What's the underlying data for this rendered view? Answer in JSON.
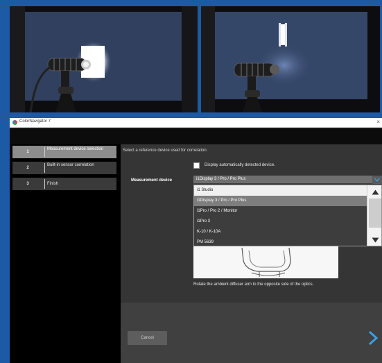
{
  "window": {
    "title": "ColorNavigator 7",
    "close_glyph": "×"
  },
  "steps": [
    {
      "number": "1",
      "label": "Measurement device selection",
      "active": true
    },
    {
      "number": "2",
      "label": "Built-in sensor correlation",
      "active": false
    },
    {
      "number": "3",
      "label": "Finish",
      "active": false
    }
  ],
  "main": {
    "instruction": "Select a reference device used for correlation.",
    "checkbox_label": "Display automatically detected device.",
    "checkbox_checked": false,
    "measurement_label": "Measurement device",
    "dropdown_value": "i1Display 3 / Pro / Pro Plus",
    "options": [
      "i1 Studio",
      "i1Display 3 / Pro / Pro Plus",
      "i1Pro / Pro 2 / Monitor",
      "i1Pro 3",
      "K-10 / K-10A",
      "PM 5639"
    ],
    "selected_index": 1,
    "help_text": "Rotate the ambient diffuser arm to the opposite side of the optics."
  },
  "footer": {
    "cancel_label": "Cancel"
  },
  "icons": {
    "dropdown_arrow": "chevron-down-icon",
    "scroll_up": "triangle-up-icon",
    "scroll_down": "triangle-down-icon",
    "next": "chevron-right-icon"
  },
  "colors": {
    "background": "#1d5aa6",
    "accent": "#3aa0e0",
    "selected_row": "#7e7e7e"
  }
}
